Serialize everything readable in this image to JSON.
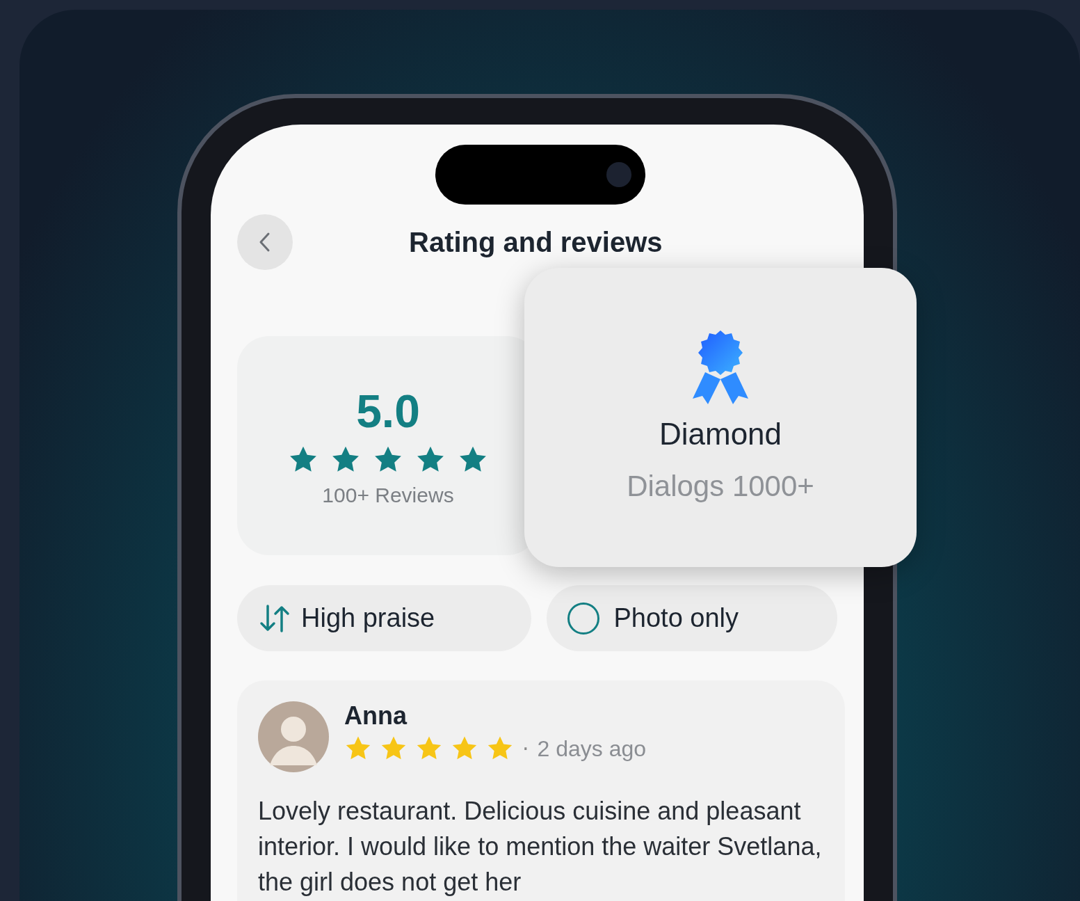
{
  "header": {
    "title": "Rating and reviews"
  },
  "rating": {
    "score": "5.0",
    "stars": 5,
    "reviews_label": "100+ Reviews"
  },
  "badge": {
    "title": "Diamond",
    "subtitle": "Dialogs 1000+"
  },
  "filters": [
    {
      "kind": "sort",
      "label": "High praise"
    },
    {
      "kind": "toggle",
      "label": "Photo only",
      "checked": false
    }
  ],
  "reviews": [
    {
      "name": "Anna",
      "stars": 5,
      "separator": "·",
      "time": "2 days ago",
      "text": "Lovely restaurant. Delicious cuisine and pleasant interior. I would like to mention the waiter Svetlana, the girl does not get her"
    }
  ]
}
